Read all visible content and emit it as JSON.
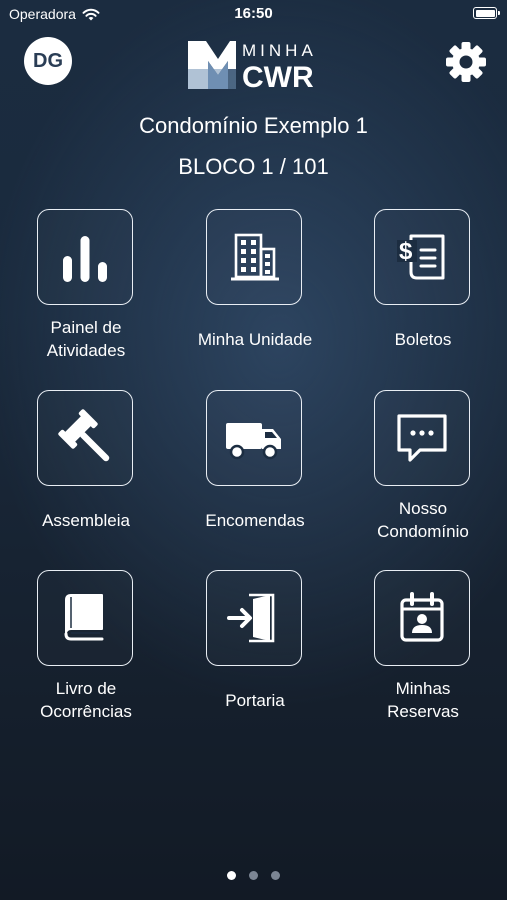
{
  "status_bar": {
    "carrier": "Operadora",
    "time": "16:50"
  },
  "header": {
    "avatar_initials": "DG",
    "logo_top": "MINHA",
    "logo_bottom": "CWR"
  },
  "condo": {
    "name": "Condomínio Exemplo 1",
    "unit": "BLOCO 1 / 101"
  },
  "tiles": [
    {
      "label_line1": "Painel de",
      "label_line2": "Atividades",
      "icon": "bar-chart-icon"
    },
    {
      "label": "Minha Unidade",
      "icon": "building-icon"
    },
    {
      "label": "Boletos",
      "icon": "invoice-icon"
    },
    {
      "label": "Assembleia",
      "icon": "gavel-icon"
    },
    {
      "label": "Encomendas",
      "icon": "truck-icon"
    },
    {
      "label_line1": "Nosso",
      "label_line2": "Condomínio",
      "icon": "chat-bubble-icon"
    },
    {
      "label_line1": "Livro de",
      "label_line2": "Ocorrências",
      "icon": "book-icon"
    },
    {
      "label": "Portaria",
      "icon": "door-enter-icon"
    },
    {
      "label_line1": "Minhas",
      "label_line2": "Reservas",
      "icon": "calendar-person-icon"
    }
  ],
  "pagination": {
    "pages": 3,
    "current": 1
  },
  "colors": {
    "background": "#1a2a3d",
    "foreground": "#ffffff",
    "logo_blue": "#6f8fb3"
  }
}
